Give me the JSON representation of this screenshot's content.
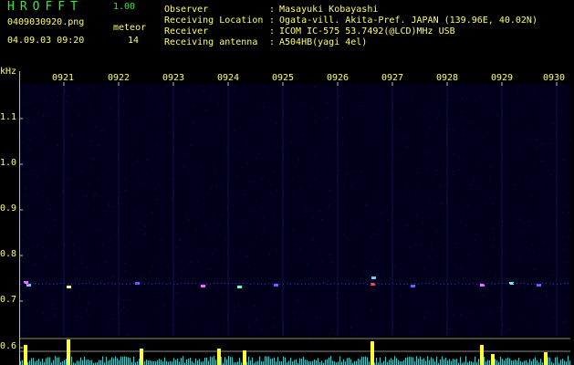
{
  "app": {
    "name": "HROFFT",
    "version": "1.00"
  },
  "file": {
    "name": "0409030920.png",
    "datetime": "04.09.03 09:20"
  },
  "meteor": {
    "label": "meteor",
    "count": "14"
  },
  "info": [
    {
      "label": "Observer",
      "value": "Masayuki Kobayashi"
    },
    {
      "label": "Receiving Location",
      "value": "Ogata-vill. Akita-Pref. JAPAN (139.96E, 40.02N)"
    },
    {
      "label": "Receiver",
      "value": "ICOM IC-575 53.7492(@LCD)MHz USB"
    },
    {
      "label": "Receiving antenna",
      "value": "A504HB(yagi 4el)"
    }
  ],
  "axis": {
    "y_unit": "kHz",
    "y_ticks": [
      "1.1",
      "1.0",
      "0.9",
      "0.8",
      "0.7",
      "0.6"
    ],
    "x_ticks": [
      "0921",
      "0922",
      "0923",
      "0924",
      "0925",
      "0926",
      "0927",
      "0928",
      "0929",
      "0930"
    ]
  },
  "colors": {
    "background": "#000000",
    "text": "#ffff66",
    "title": "#33ee33",
    "spectrum": "#00001a"
  }
}
